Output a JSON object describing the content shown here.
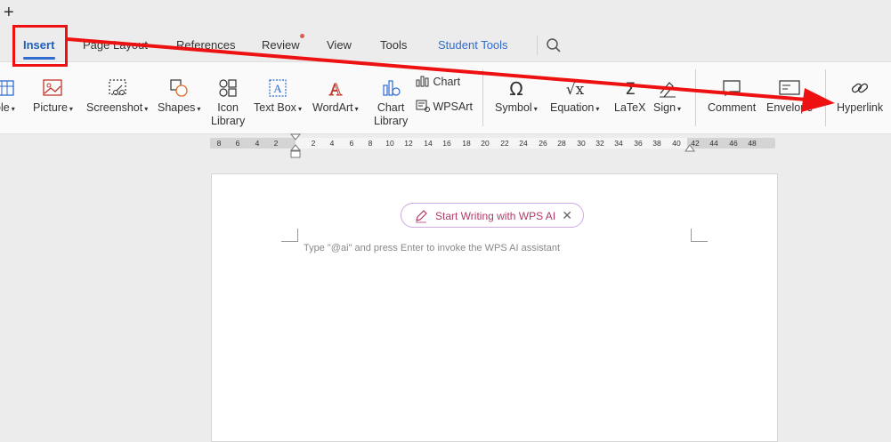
{
  "title_bar": {
    "new_tab_symbol": "+"
  },
  "tabs": [
    {
      "label": "Insert",
      "active": true
    },
    {
      "label": "Page Layout"
    },
    {
      "label": "References"
    },
    {
      "label": "Review",
      "has_notification_dot": true
    },
    {
      "label": "View"
    },
    {
      "label": "Tools"
    },
    {
      "label": "Student Tools"
    }
  ],
  "ribbon": {
    "table_partial": "ole",
    "picture": "Picture",
    "screenshot": "Screenshot",
    "shapes": "Shapes",
    "icon_library": [
      "Icon",
      "Library"
    ],
    "text_box": "Text Box",
    "wordart": "WordArt",
    "chart_library": [
      "Chart",
      "Library"
    ],
    "chart": "Chart",
    "wpsart": "WPSArt",
    "symbol": "Symbol",
    "equation": "Equation",
    "latex": "LaTeX",
    "sign": "Sign",
    "comment": "Comment",
    "envelope": "Envelope",
    "hyperlink": "Hyperlink"
  },
  "ruler": {
    "left_ticks": [
      "8",
      "6",
      "4",
      "2"
    ],
    "right_ticks": [
      "2",
      "4",
      "6",
      "8",
      "10",
      "12",
      "14",
      "16",
      "18",
      "20",
      "22",
      "24",
      "26",
      "28",
      "30",
      "32",
      "34",
      "36",
      "38",
      "40",
      "42",
      "44",
      "46",
      "48"
    ]
  },
  "document": {
    "ai_button_label": "Start Writing with WPS AI",
    "ai_hint": "Type \"@ai\" and press Enter to invoke the WPS AI assistant"
  },
  "annotation": {
    "color": "#ee1111",
    "highlight_target": "Insert",
    "arrow_target": "Hyperlink"
  },
  "colors": {
    "accent": "#2f6bd0",
    "notification": "#e05a4e"
  }
}
